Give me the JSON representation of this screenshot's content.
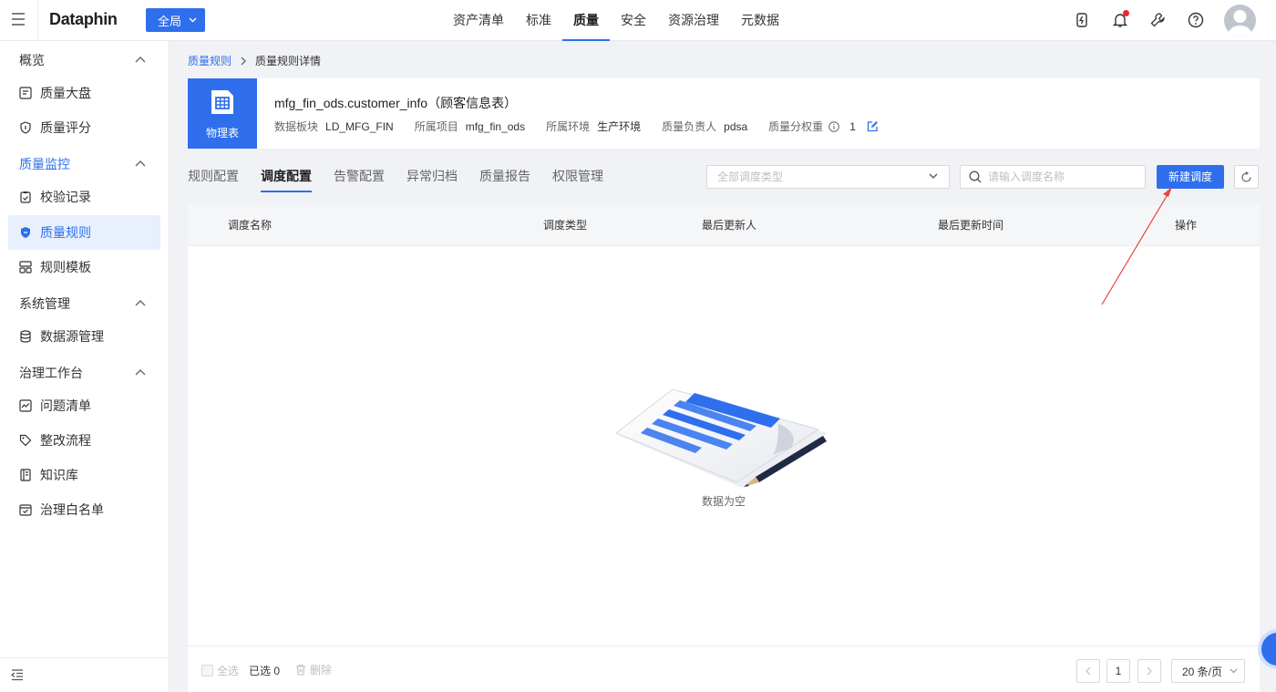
{
  "topbar": {
    "logo": "Dataphin",
    "scope_label": "全局",
    "nav": [
      "资产清单",
      "标准",
      "质量",
      "安全",
      "资源治理",
      "元数据"
    ],
    "nav_active": "质量",
    "icons": [
      "power-icon",
      "bell-icon",
      "wrench-icon",
      "help-icon",
      "avatar"
    ]
  },
  "sidebar": {
    "overview": "概览",
    "item_dashboard": "质量大盘",
    "item_score": "质量评分",
    "monitor": "质量监控",
    "item_records": "校验记录",
    "item_rules": "质量规则",
    "item_templates": "规则模板",
    "system": "系统管理",
    "item_datasource": "数据源管理",
    "governance": "治理工作台",
    "item_issues": "问题清单",
    "item_rectify": "整改流程",
    "item_kb": "知识库",
    "item_whitelist": "治理白名单"
  },
  "breadcrumb": {
    "parent": "质量规则",
    "current": "质量规则详情"
  },
  "info": {
    "badge": "物理表",
    "table_name": "mfg_fin_ods.customer_info（顾客信息表）",
    "block_label": "数据板块",
    "block_value": "LD_MFG_FIN",
    "project_label": "所属项目",
    "project_value": "mfg_fin_ods",
    "env_label": "所属环境",
    "env_value": "生产环境",
    "owner_label": "质量负责人",
    "owner_value": "pdsa",
    "weight_label": "质量分权重",
    "weight_value": "1"
  },
  "tabs": [
    "规则配置",
    "调度配置",
    "告警配置",
    "异常归档",
    "质量报告",
    "权限管理"
  ],
  "active_tab": "调度配置",
  "toolbar": {
    "type_placeholder": "全部调度类型",
    "search_placeholder": "请输入调度名称",
    "new_button": "新建调度"
  },
  "table": {
    "columns": [
      "调度名称",
      "调度类型",
      "最后更新人",
      "最后更新时间",
      "操作"
    ],
    "rows": [],
    "empty_text": "数据为空"
  },
  "footer": {
    "select_all": "全选",
    "selected": "已选 0",
    "delete": "删除",
    "page": "1",
    "page_size": "20 条/页"
  },
  "colors": {
    "primary": "#2f6fed",
    "active_bg": "#e8f0fd",
    "annotation_arrow": "#e8453c"
  }
}
